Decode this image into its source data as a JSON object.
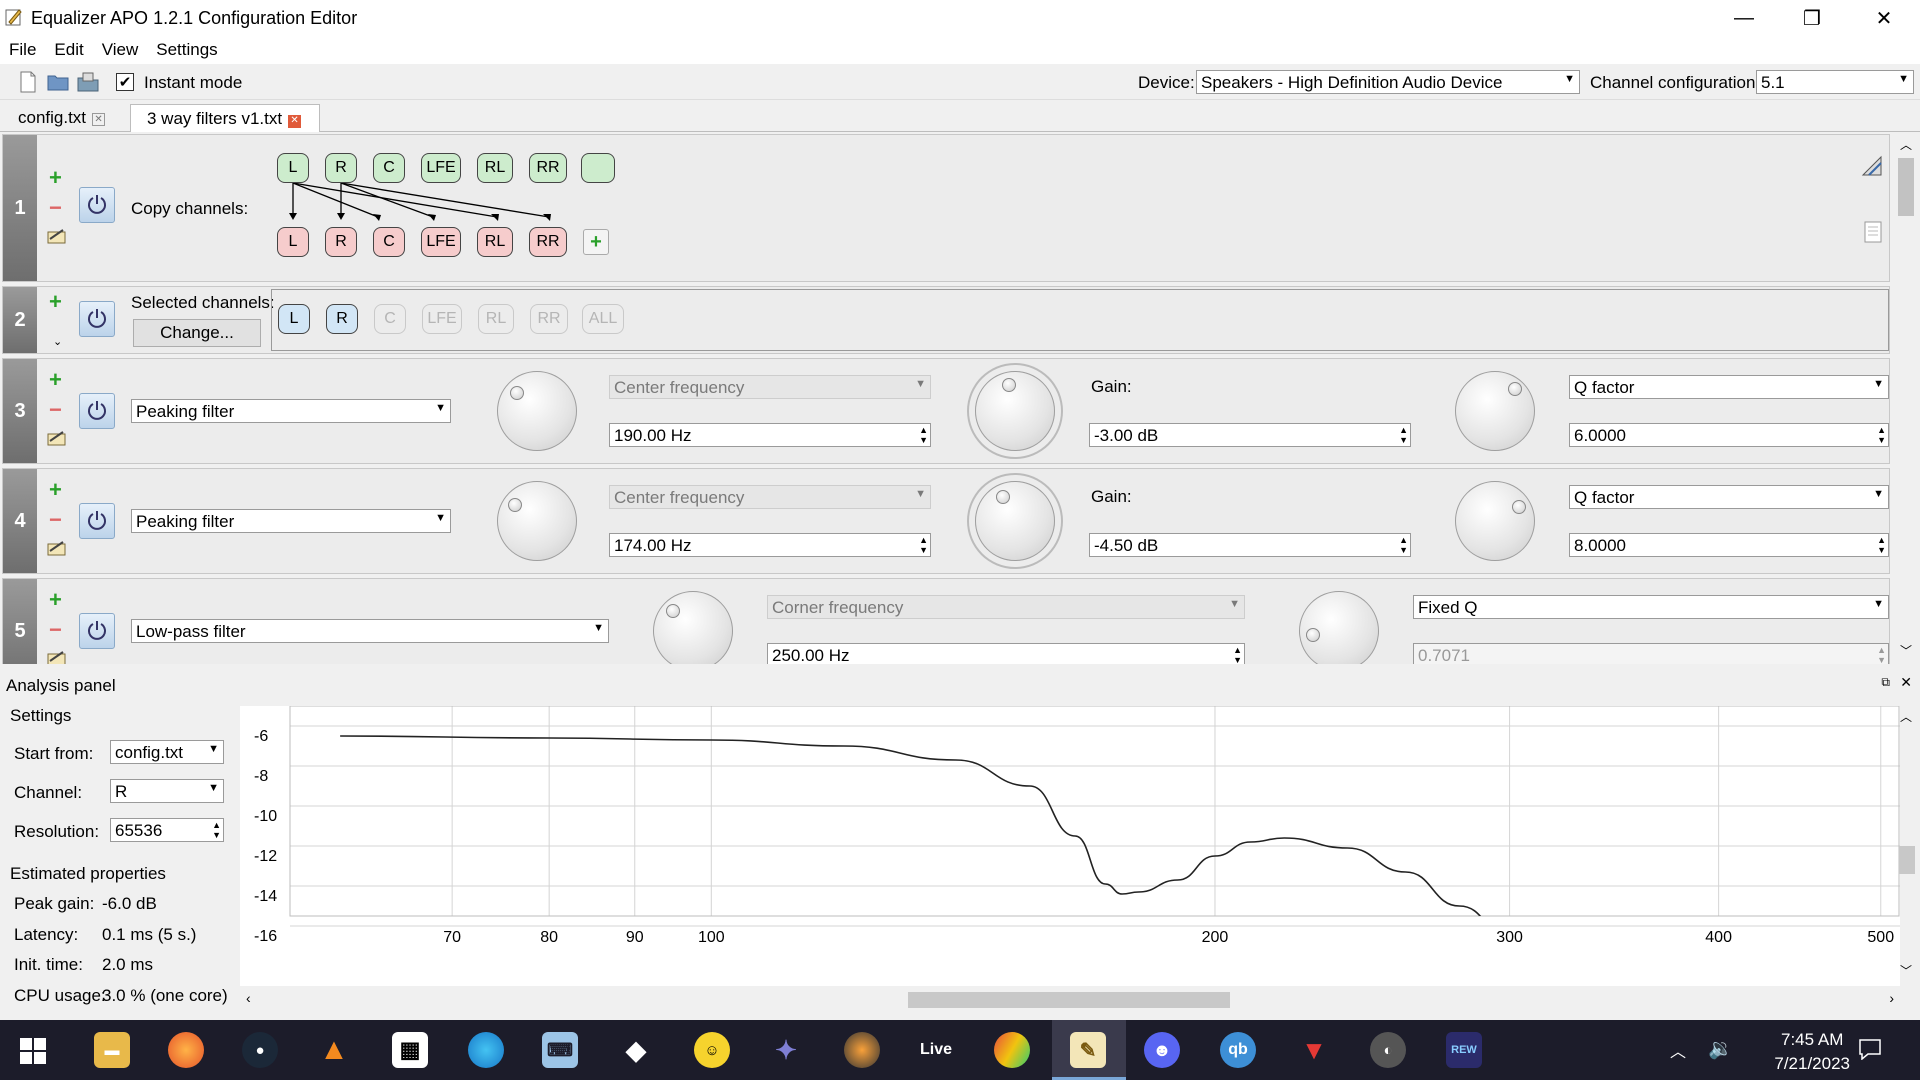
{
  "window": {
    "title": "Equalizer APO 1.2.1 Configuration Editor"
  },
  "menu": [
    "File",
    "Edit",
    "View",
    "Settings"
  ],
  "toolbar": {
    "instant_mode_label": "Instant mode",
    "instant_mode_checked": true,
    "device_label": "Device:",
    "device_value": "Speakers - High Definition Audio Device",
    "channel_config_label": "Channel configuration:",
    "channel_config_value": "5.1"
  },
  "tabs": [
    {
      "label": "config.txt",
      "active": false
    },
    {
      "label": "3 way filters v1.txt",
      "active": true
    }
  ],
  "filters": {
    "row1": {
      "number": "1",
      "label": "Copy channels:",
      "source_channels": [
        "L",
        "R",
        "C",
        "LFE",
        "RL",
        "RR",
        ""
      ],
      "target_channels": [
        "L",
        "R",
        "C",
        "LFE",
        "RL",
        "RR"
      ]
    },
    "row2": {
      "number": "2",
      "label": "Selected channels:",
      "change_button": "Change...",
      "channels": [
        "L",
        "R",
        "C",
        "LFE",
        "RL",
        "RR",
        "ALL"
      ],
      "selected": [
        "L",
        "R"
      ]
    },
    "row3": {
      "number": "3",
      "type": "Peaking filter",
      "freq_mode": "Center frequency",
      "freq_value": "190.00 Hz",
      "gain_label": "Gain:",
      "gain_value": "-3.00 dB",
      "q_mode": "Q factor",
      "q_value": "6.0000"
    },
    "row4": {
      "number": "4",
      "type": "Peaking filter",
      "freq_mode": "Center frequency",
      "freq_value": "174.00 Hz",
      "gain_label": "Gain:",
      "gain_value": "-4.50 dB",
      "q_mode": "Q factor",
      "q_value": "8.0000"
    },
    "row5": {
      "number": "5",
      "type": "Low-pass filter",
      "freq_mode": "Corner frequency",
      "freq_value": "250.00 Hz",
      "q_mode": "Fixed Q",
      "q_value": "0.7071"
    }
  },
  "analysis": {
    "title": "Analysis panel",
    "settings_label": "Settings",
    "start_from_label": "Start from:",
    "start_from_value": "config.txt",
    "channel_label": "Channel:",
    "channel_value": "R",
    "resolution_label": "Resolution:",
    "resolution_value": "65536",
    "estimated_label": "Estimated properties",
    "peak_gain_label": "Peak gain:",
    "peak_gain_value": "-6.0 dB",
    "latency_label": "Latency:",
    "latency_value": "0.1 ms (5 s.)",
    "init_time_label": "Init. time:",
    "init_time_value": "2.0 ms",
    "cpu_label": "CPU usage:",
    "cpu_value": "3.0 % (one core)",
    "plot": {
      "y_ticks": [
        "-6",
        "-8",
        "-10",
        "-12",
        "-14",
        "-16"
      ],
      "x_ticks": [
        "70",
        "80",
        "90",
        "100",
        "200",
        "300",
        "400",
        "500"
      ],
      "curve": [
        [
          60,
          -6.0
        ],
        [
          80,
          -6.1
        ],
        [
          100,
          -6.2
        ],
        [
          120,
          -6.5
        ],
        [
          140,
          -7.2
        ],
        [
          155,
          -8.5
        ],
        [
          165,
          -11.0
        ],
        [
          172,
          -13.4
        ],
        [
          176,
          -13.9
        ],
        [
          180,
          -13.8
        ],
        [
          190,
          -13.2
        ],
        [
          200,
          -12.0
        ],
        [
          210,
          -11.3
        ],
        [
          220,
          -11.1
        ],
        [
          240,
          -11.6
        ],
        [
          260,
          -12.8
        ],
        [
          280,
          -14.5
        ],
        [
          300,
          -16.0
        ],
        [
          320,
          -17.2
        ]
      ]
    }
  },
  "taskbar": {
    "time": "7:45 AM",
    "date": "7/21/2023",
    "apps": [
      "Live",
      "REW"
    ]
  },
  "colors": {
    "accent": "#2aa02a",
    "taskbar_bg": "#1c1c2a"
  }
}
